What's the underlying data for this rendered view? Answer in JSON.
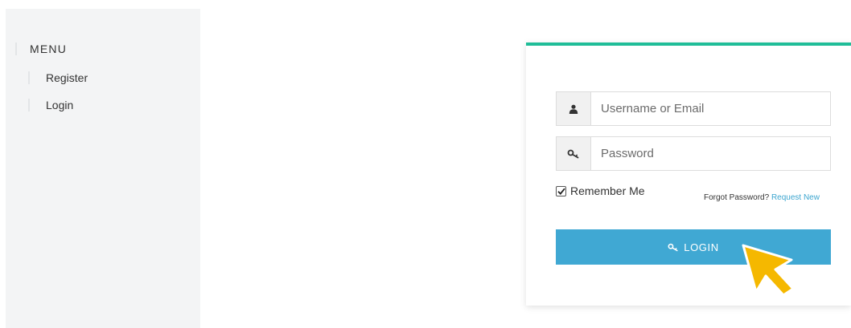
{
  "sidebar": {
    "heading": "MENU",
    "items": [
      {
        "label": "Register"
      },
      {
        "label": "Login"
      }
    ]
  },
  "login_form": {
    "username_placeholder": "Username or Email",
    "username_value": "",
    "password_placeholder": "Password",
    "password_value": "",
    "remember_label": "Remember Me",
    "remember_checked": true,
    "forgot_text": "Forgot Password?",
    "request_new_link": "Request New",
    "login_button_label": "LOGIN",
    "icons": {
      "username": "user-icon",
      "password": "key-icon",
      "button": "key-icon"
    }
  },
  "colors": {
    "accent_top_border": "#1fbd98",
    "login_button": "#40a8d3",
    "link": "#3ca5cf",
    "cursor": "#f5b800",
    "sidebar_bg": "#f3f4f5"
  }
}
